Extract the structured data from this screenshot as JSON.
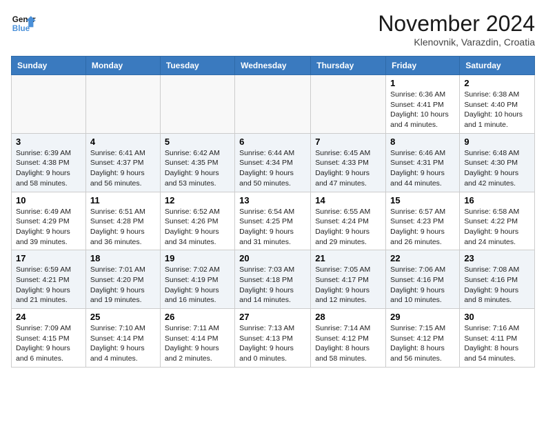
{
  "header": {
    "logo_line1": "General",
    "logo_line2": "Blue",
    "month_title": "November 2024",
    "location": "Klenovnik, Varazdin, Croatia"
  },
  "weekdays": [
    "Sunday",
    "Monday",
    "Tuesday",
    "Wednesday",
    "Thursday",
    "Friday",
    "Saturday"
  ],
  "weeks": [
    [
      {
        "day": "",
        "info": ""
      },
      {
        "day": "",
        "info": ""
      },
      {
        "day": "",
        "info": ""
      },
      {
        "day": "",
        "info": ""
      },
      {
        "day": "",
        "info": ""
      },
      {
        "day": "1",
        "info": "Sunrise: 6:36 AM\nSunset: 4:41 PM\nDaylight: 10 hours\nand 4 minutes."
      },
      {
        "day": "2",
        "info": "Sunrise: 6:38 AM\nSunset: 4:40 PM\nDaylight: 10 hours\nand 1 minute."
      }
    ],
    [
      {
        "day": "3",
        "info": "Sunrise: 6:39 AM\nSunset: 4:38 PM\nDaylight: 9 hours\nand 58 minutes."
      },
      {
        "day": "4",
        "info": "Sunrise: 6:41 AM\nSunset: 4:37 PM\nDaylight: 9 hours\nand 56 minutes."
      },
      {
        "day": "5",
        "info": "Sunrise: 6:42 AM\nSunset: 4:35 PM\nDaylight: 9 hours\nand 53 minutes."
      },
      {
        "day": "6",
        "info": "Sunrise: 6:44 AM\nSunset: 4:34 PM\nDaylight: 9 hours\nand 50 minutes."
      },
      {
        "day": "7",
        "info": "Sunrise: 6:45 AM\nSunset: 4:33 PM\nDaylight: 9 hours\nand 47 minutes."
      },
      {
        "day": "8",
        "info": "Sunrise: 6:46 AM\nSunset: 4:31 PM\nDaylight: 9 hours\nand 44 minutes."
      },
      {
        "day": "9",
        "info": "Sunrise: 6:48 AM\nSunset: 4:30 PM\nDaylight: 9 hours\nand 42 minutes."
      }
    ],
    [
      {
        "day": "10",
        "info": "Sunrise: 6:49 AM\nSunset: 4:29 PM\nDaylight: 9 hours\nand 39 minutes."
      },
      {
        "day": "11",
        "info": "Sunrise: 6:51 AM\nSunset: 4:28 PM\nDaylight: 9 hours\nand 36 minutes."
      },
      {
        "day": "12",
        "info": "Sunrise: 6:52 AM\nSunset: 4:26 PM\nDaylight: 9 hours\nand 34 minutes."
      },
      {
        "day": "13",
        "info": "Sunrise: 6:54 AM\nSunset: 4:25 PM\nDaylight: 9 hours\nand 31 minutes."
      },
      {
        "day": "14",
        "info": "Sunrise: 6:55 AM\nSunset: 4:24 PM\nDaylight: 9 hours\nand 29 minutes."
      },
      {
        "day": "15",
        "info": "Sunrise: 6:57 AM\nSunset: 4:23 PM\nDaylight: 9 hours\nand 26 minutes."
      },
      {
        "day": "16",
        "info": "Sunrise: 6:58 AM\nSunset: 4:22 PM\nDaylight: 9 hours\nand 24 minutes."
      }
    ],
    [
      {
        "day": "17",
        "info": "Sunrise: 6:59 AM\nSunset: 4:21 PM\nDaylight: 9 hours\nand 21 minutes."
      },
      {
        "day": "18",
        "info": "Sunrise: 7:01 AM\nSunset: 4:20 PM\nDaylight: 9 hours\nand 19 minutes."
      },
      {
        "day": "19",
        "info": "Sunrise: 7:02 AM\nSunset: 4:19 PM\nDaylight: 9 hours\nand 16 minutes."
      },
      {
        "day": "20",
        "info": "Sunrise: 7:03 AM\nSunset: 4:18 PM\nDaylight: 9 hours\nand 14 minutes."
      },
      {
        "day": "21",
        "info": "Sunrise: 7:05 AM\nSunset: 4:17 PM\nDaylight: 9 hours\nand 12 minutes."
      },
      {
        "day": "22",
        "info": "Sunrise: 7:06 AM\nSunset: 4:16 PM\nDaylight: 9 hours\nand 10 minutes."
      },
      {
        "day": "23",
        "info": "Sunrise: 7:08 AM\nSunset: 4:16 PM\nDaylight: 9 hours\nand 8 minutes."
      }
    ],
    [
      {
        "day": "24",
        "info": "Sunrise: 7:09 AM\nSunset: 4:15 PM\nDaylight: 9 hours\nand 6 minutes."
      },
      {
        "day": "25",
        "info": "Sunrise: 7:10 AM\nSunset: 4:14 PM\nDaylight: 9 hours\nand 4 minutes."
      },
      {
        "day": "26",
        "info": "Sunrise: 7:11 AM\nSunset: 4:14 PM\nDaylight: 9 hours\nand 2 minutes."
      },
      {
        "day": "27",
        "info": "Sunrise: 7:13 AM\nSunset: 4:13 PM\nDaylight: 9 hours\nand 0 minutes."
      },
      {
        "day": "28",
        "info": "Sunrise: 7:14 AM\nSunset: 4:12 PM\nDaylight: 8 hours\nand 58 minutes."
      },
      {
        "day": "29",
        "info": "Sunrise: 7:15 AM\nSunset: 4:12 PM\nDaylight: 8 hours\nand 56 minutes."
      },
      {
        "day": "30",
        "info": "Sunrise: 7:16 AM\nSunset: 4:11 PM\nDaylight: 8 hours\nand 54 minutes."
      }
    ]
  ]
}
